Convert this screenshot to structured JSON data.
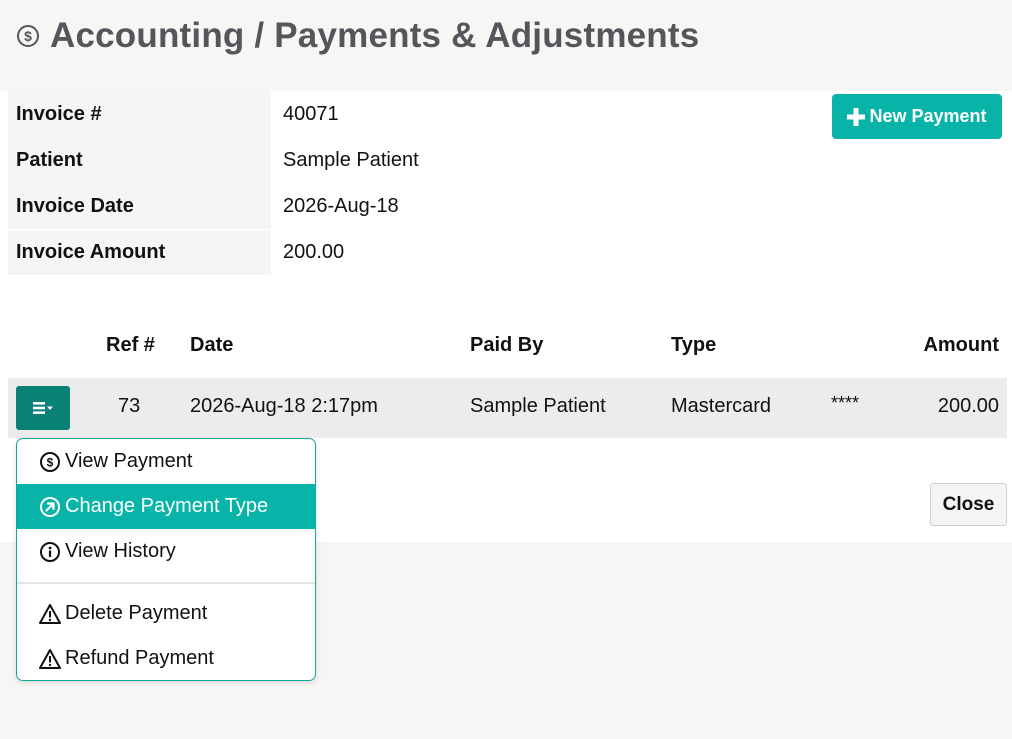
{
  "header": {
    "title": "Accounting / Payments & Adjustments",
    "icon": "dollar-circle-icon"
  },
  "invoice": {
    "rows": [
      {
        "label": "Invoice #",
        "value": "40071"
      },
      {
        "label": "Patient",
        "value": "Sample Patient"
      },
      {
        "label": "Invoice Date",
        "value": "2026-Aug-18"
      },
      {
        "label": "Invoice Amount",
        "value": "200.00"
      }
    ]
  },
  "actions": {
    "new_payment": "New Payment",
    "close": "Close"
  },
  "payments_table": {
    "columns": {
      "ref": "Ref #",
      "date": "Date",
      "paid_by": "Paid By",
      "type": "Type",
      "amount": "Amount"
    },
    "rows": [
      {
        "ref": "73",
        "date": "2026-Aug-18 2:17pm",
        "paid_by": "Sample Patient",
        "type": "Mastercard",
        "card": "****",
        "amount": "200.00"
      }
    ]
  },
  "row_menu": {
    "items": [
      {
        "label": "View Payment",
        "icon": "dollar-circle-icon"
      },
      {
        "label": "Change Payment Type",
        "icon": "arrow-up-right-circle-icon",
        "active": true
      },
      {
        "label": "View History",
        "icon": "info-circle-icon"
      },
      {
        "label": "Delete Payment",
        "icon": "warning-triangle-icon"
      },
      {
        "label": "Refund Payment",
        "icon": "warning-triangle-icon"
      }
    ]
  },
  "colors": {
    "accent": "#08b3a8",
    "accent_dark": "#0b8276",
    "title": "#55555c"
  }
}
